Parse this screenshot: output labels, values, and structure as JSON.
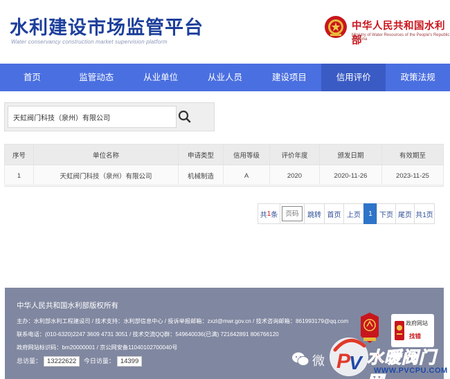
{
  "header": {
    "title": "水利建设市场监管平台",
    "subtitle": "Water conservancy construction market supervision platform",
    "ministry_name": "中华人民共和国水利部",
    "ministry_en": "Ministry of Water Resources of the People's Republic of China"
  },
  "nav": {
    "items": [
      {
        "label": "首页"
      },
      {
        "label": "监管动态"
      },
      {
        "label": "从业单位"
      },
      {
        "label": "从业人员"
      },
      {
        "label": "建设项目"
      },
      {
        "label": "信用评价",
        "active": true
      },
      {
        "label": "政策法规"
      }
    ]
  },
  "search": {
    "value": "天虹阀门科技（泉州）有限公司",
    "icon": "search-icon"
  },
  "table": {
    "headers": [
      "序号",
      "单位名称",
      "申请类型",
      "信用等级",
      "评价年度",
      "颁发日期",
      "有效期至"
    ],
    "rows": [
      [
        "1",
        "天虹阀门科技（泉州）有限公司",
        "机械制造",
        "A",
        "2020",
        "2020-11-26",
        "2023-11-25"
      ]
    ]
  },
  "pagination": {
    "total_prefix": "共",
    "total_count": "1",
    "total_suffix": "条",
    "input_placeholder": "页码",
    "jump": "跳转",
    "first": "首页",
    "prev": "上页",
    "current": "1",
    "next": "下页",
    "last": "尾页",
    "total_pages": "共1页"
  },
  "footer": {
    "copyright": "中华人民共和国水利部版权所有",
    "line1": "主办：水利部水利工程建设司 / 技术支持：水利部信息中心 / 投诉举报邮箱：zxzl@mwr.gov.cn / 技术咨询邮箱：861993179@qq.com",
    "line2": "联系电话：(010-6320)2247 3609 4731 3051 / 技术交流QQ群：549640036(已满) 721642891 806766120",
    "line3": "政府网站标识码：bm20000001 / 京公网安备11040102700040号",
    "visits_label": "总访量：",
    "visits_total": "13222622",
    "today_label": "今日访量：",
    "visits_today": "14399",
    "gov_badge_line1": "政府网站",
    "gov_badge_line2": "找错"
  },
  "watermark": {
    "wechat_text": "微",
    "brand_name": "水暖阀门网",
    "brand_url": "WWW.PVCPU.COM"
  },
  "colors": {
    "title_blue": "#1d3f9b",
    "nav_bg": "#4a6fe0",
    "nav_active": "#3a5bc4",
    "ministry_red": "#c8161d",
    "page_current": "#2e74c8",
    "footer_bg": "#8087a0"
  }
}
